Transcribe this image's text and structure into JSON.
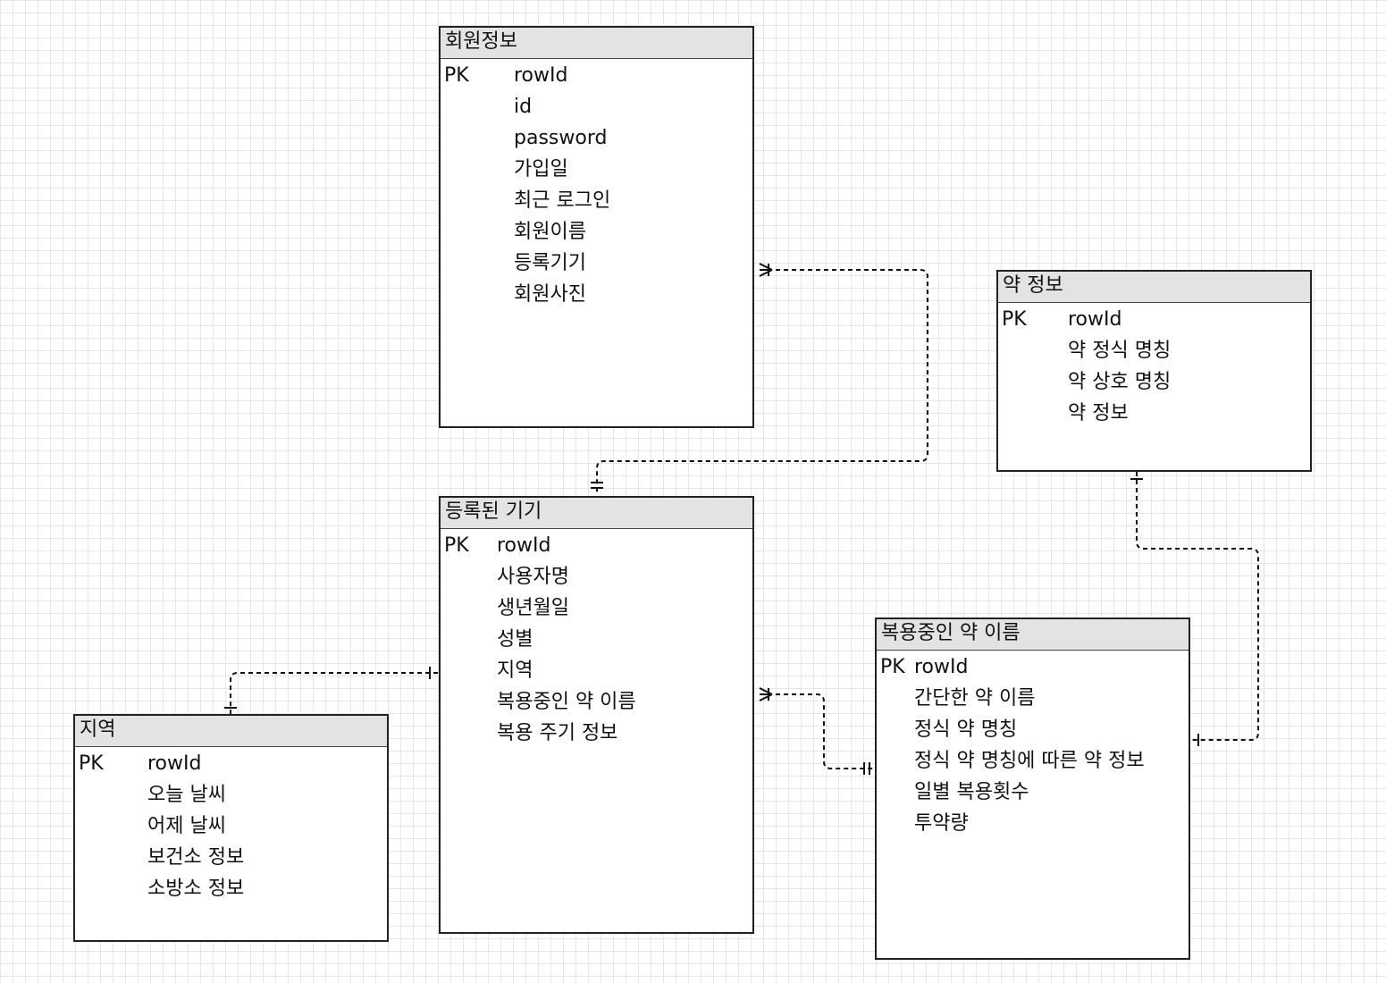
{
  "entities": {
    "member_info": {
      "title": "회원정보",
      "pk": "PK",
      "fields": [
        "rowId",
        "id",
        "password",
        "가입일",
        "최근 로그인",
        "회원이름",
        "등록기기",
        "회원사진"
      ]
    },
    "drug_info": {
      "title": "약 정보",
      "pk": "PK",
      "fields": [
        "rowId",
        "약 정식 명칭",
        "약 상호 명칭",
        "약 정보"
      ]
    },
    "registered_device": {
      "title": "등록된 기기",
      "pk": "PK",
      "fields": [
        "rowId",
        "사용자명",
        "생년월일",
        "성별",
        "지역",
        "복용중인 약 이름",
        "복용 주기 정보"
      ]
    },
    "region": {
      "title": "지역",
      "pk": "PK",
      "fields": [
        "rowId",
        "오늘 날씨",
        "어제 날씨",
        "보건소 정보",
        "소방소 정보"
      ]
    },
    "medication": {
      "title": "복용중인 약 이름",
      "pk": "PK",
      "fields": [
        "rowId",
        "간단한 약 이름",
        "정식 약 명칭",
        "정식 약 명칭에 따른 약 정보",
        "일별 복용횟수",
        "투약량"
      ]
    }
  },
  "relationships": [
    {
      "from": "member_info",
      "to": "registered_device",
      "from_end": "one-or-many",
      "to_end": "one-and-only-one"
    },
    {
      "from": "registered_device",
      "to": "region",
      "from_end": "one",
      "to_end": "one"
    },
    {
      "from": "registered_device",
      "to": "medication",
      "from_end": "one-or-many",
      "to_end": "one-and-only-one"
    },
    {
      "from": "drug_info",
      "to": "medication",
      "from_end": "one",
      "to_end": "one"
    }
  ],
  "colors": {
    "header_fill": "#e3e3e3",
    "border": "#222222",
    "grid": "#e6e6e6"
  }
}
